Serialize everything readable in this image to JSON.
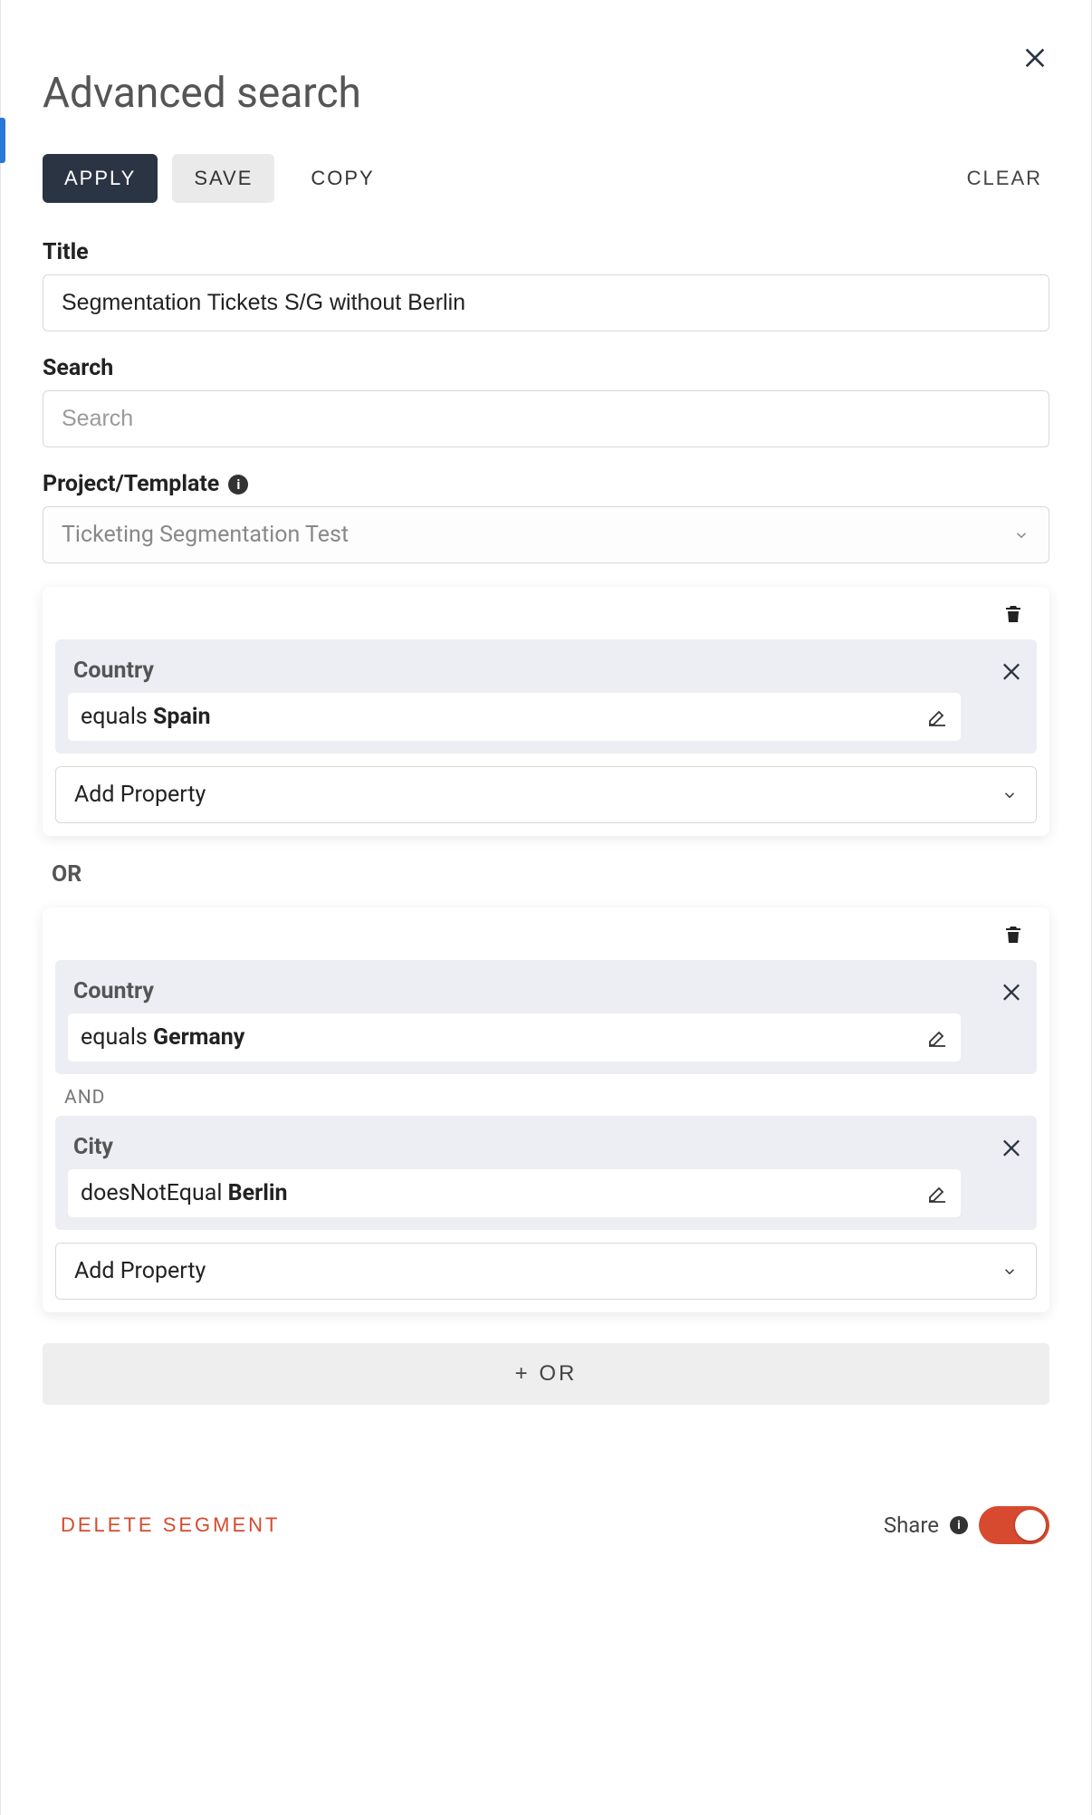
{
  "header": {
    "title": "Advanced search"
  },
  "toolbar": {
    "apply": "APPLY",
    "save": "SAVE",
    "copy": "COPY",
    "clear": "CLEAR"
  },
  "fields": {
    "title_label": "Title",
    "title_value": "Segmentation Tickets S/G without Berlin",
    "search_label": "Search",
    "search_placeholder": "Search",
    "project_label": "Project/Template",
    "project_value": "Ticketing Segmentation Test"
  },
  "groups": [
    {
      "conditions": [
        {
          "property": "Country",
          "operator": "equals",
          "value": "Spain"
        }
      ],
      "add_property": "Add Property"
    },
    {
      "conditions": [
        {
          "property": "Country",
          "operator": "equals",
          "value": "Germany"
        },
        {
          "property": "City",
          "operator": "doesNotEqual",
          "value": "Berlin"
        }
      ],
      "add_property": "Add Property"
    }
  ],
  "connectors": {
    "or": "OR",
    "and": "AND",
    "add_or": "+ OR"
  },
  "footer": {
    "delete": "DELETE SEGMENT",
    "share_label": "Share",
    "share_on": true
  }
}
